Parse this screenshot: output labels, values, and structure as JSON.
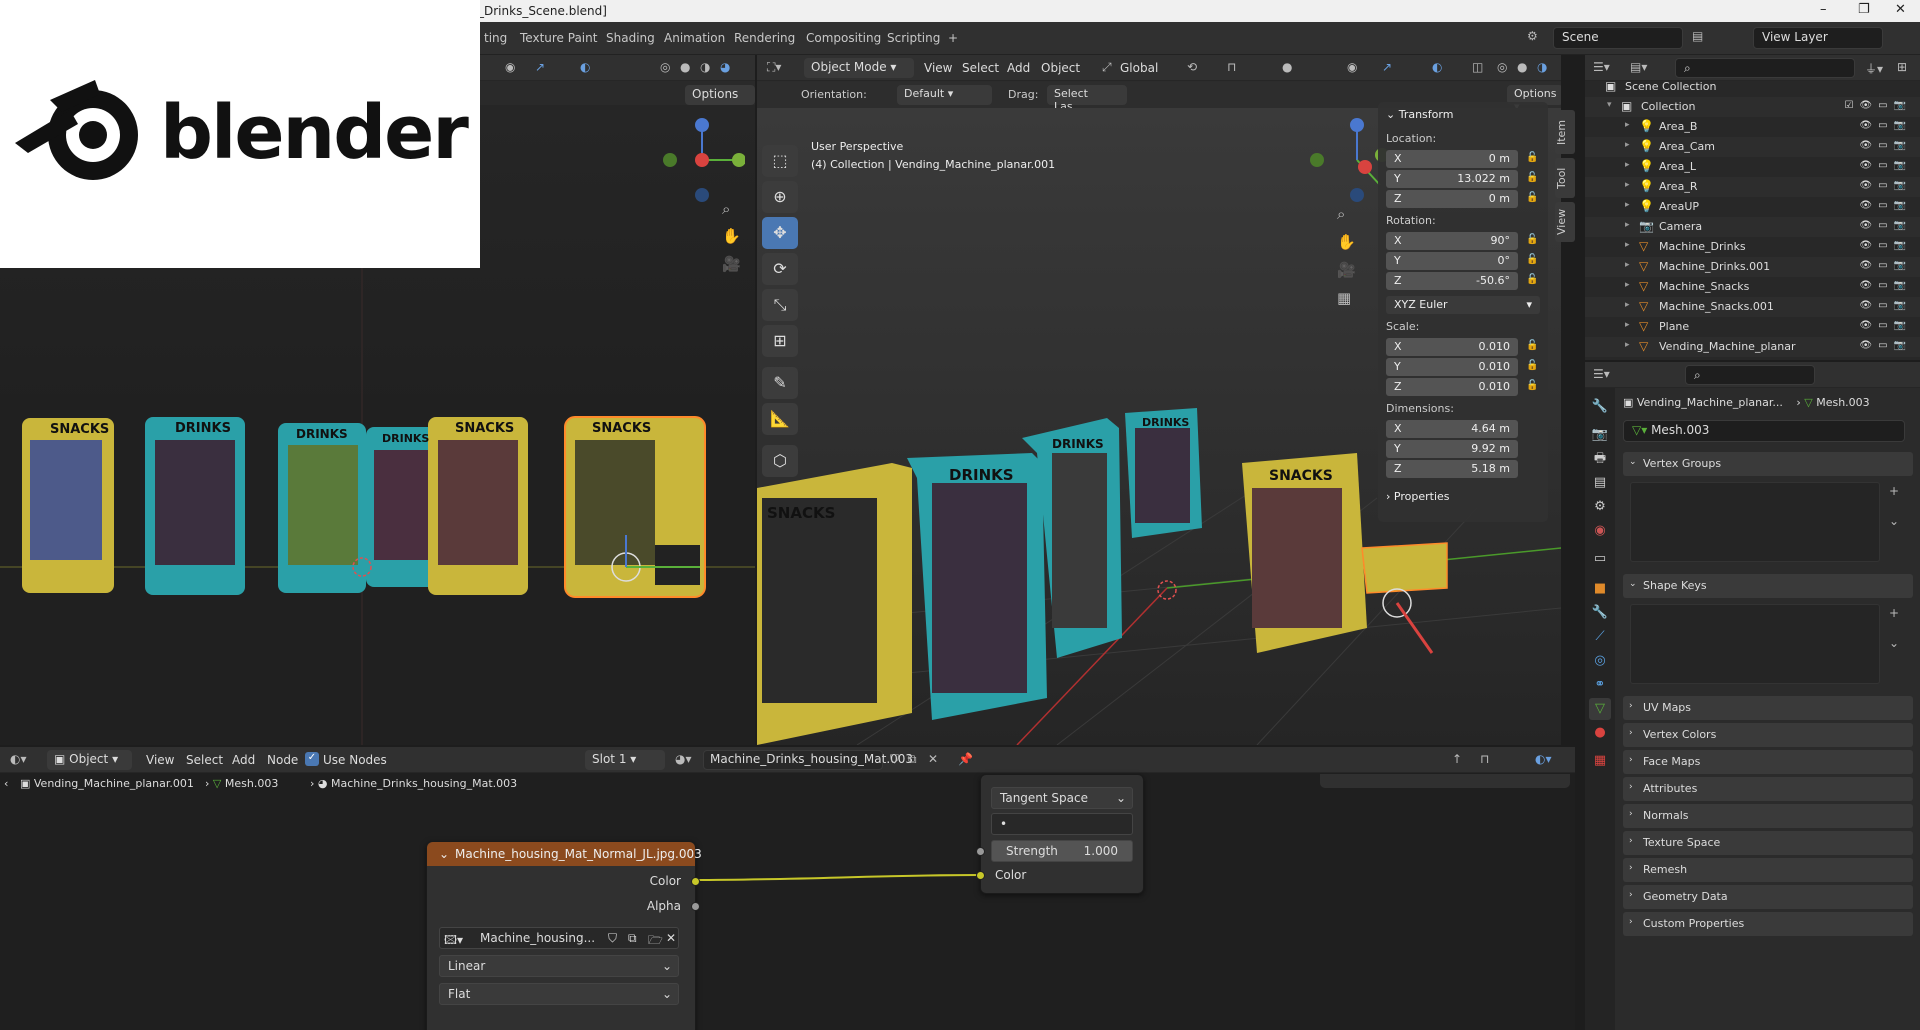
{
  "window": {
    "title": "_Drinks_Scene.blend]",
    "controls": [
      "–",
      "❐",
      "✕"
    ]
  },
  "workspace": {
    "tabs": [
      "ting",
      "Texture Paint",
      "Shading",
      "Animation",
      "Rendering",
      "Compositing",
      "Scripting",
      "+"
    ],
    "scene": "Scene",
    "view_layer": "View Layer"
  },
  "logo": {
    "text": "blender"
  },
  "left_viewport": {
    "options_label": "Options",
    "labels": [
      "SNACKS",
      "DRINKS",
      "DRINKS",
      "DRINKS",
      "SNACKS",
      "SNACKS"
    ]
  },
  "right_viewport": {
    "mode": "Object Mode",
    "menu": [
      "View",
      "Select",
      "Add",
      "Object"
    ],
    "transform_orientation": "Global",
    "orientation_label": "Orientation:",
    "orientation_value": "Default",
    "drag_label": "Drag:",
    "drag_value": "Select Las...",
    "options_label": "Options",
    "overlay_line1": "User Perspective",
    "overlay_line2": "(4) Collection | Vending_Machine_planar.001",
    "side_tabs": [
      "Item",
      "Tool",
      "View"
    ],
    "labels": [
      "SNACKS",
      "DRINKS",
      "DRINKS",
      "DRINKS",
      "SNACKS"
    ]
  },
  "npanel": {
    "title": "Transform",
    "location_label": "Location:",
    "location": [
      {
        "axis": "X",
        "value": "0 m"
      },
      {
        "axis": "Y",
        "value": "13.022 m"
      },
      {
        "axis": "Z",
        "value": "0 m"
      }
    ],
    "rotation_label": "Rotation:",
    "rotation": [
      {
        "axis": "X",
        "value": "90°"
      },
      {
        "axis": "Y",
        "value": "0°"
      },
      {
        "axis": "Z",
        "value": "-50.6°"
      }
    ],
    "rotation_mode": "XYZ Euler",
    "scale_label": "Scale:",
    "scale": [
      {
        "axis": "X",
        "value": "0.010"
      },
      {
        "axis": "Y",
        "value": "0.010"
      },
      {
        "axis": "Z",
        "value": "0.010"
      }
    ],
    "dimensions_label": "Dimensions:",
    "dimensions": [
      {
        "axis": "X",
        "value": "4.64 m"
      },
      {
        "axis": "Y",
        "value": "9.92 m"
      },
      {
        "axis": "Z",
        "value": "5.18 m"
      }
    ],
    "properties_label": "Properties"
  },
  "outliner": {
    "scene_collection": "Scene Collection",
    "collection": "Collection",
    "items": [
      {
        "name": "Area_B",
        "icon": "light-icon"
      },
      {
        "name": "Area_Cam",
        "icon": "light-icon"
      },
      {
        "name": "Area_L",
        "icon": "light-icon"
      },
      {
        "name": "Area_R",
        "icon": "light-icon"
      },
      {
        "name": "AreaUP",
        "icon": "light-icon"
      },
      {
        "name": "Camera",
        "icon": "camera-icon"
      },
      {
        "name": "Machine_Drinks",
        "icon": "mesh-icon"
      },
      {
        "name": "Machine_Drinks.001",
        "icon": "mesh-icon"
      },
      {
        "name": "Machine_Snacks",
        "icon": "mesh-icon"
      },
      {
        "name": "Machine_Snacks.001",
        "icon": "mesh-icon"
      },
      {
        "name": "Plane",
        "icon": "mesh-icon"
      },
      {
        "name": "Vending_Machine_planar",
        "icon": "mesh-icon"
      }
    ]
  },
  "properties": {
    "breadcrumb_object": "Vending_Machine_planar...",
    "breadcrumb_mesh": "Mesh.003",
    "mesh_name": "Mesh.003",
    "sections_open": [
      "Vertex Groups",
      "Shape Keys"
    ],
    "sections_closed": [
      "UV Maps",
      "Vertex Colors",
      "Face Maps",
      "Attributes",
      "Normals",
      "Texture Space",
      "Remesh",
      "Geometry Data",
      "Custom Properties"
    ]
  },
  "node_editor": {
    "editor_type": "Object",
    "menu": [
      "View",
      "Select",
      "Add",
      "Node"
    ],
    "use_nodes_label": "Use Nodes",
    "slot": "Slot 1",
    "material": "Machine_Drinks_housing_Mat.003",
    "breadcrumb": [
      "Vending_Machine_planar.001",
      "Mesh.003",
      "Machine_Drinks_housing_Mat.003"
    ],
    "image_node": {
      "title": "Machine_housing_Mat_Normal_JL.jpg.003",
      "out_color": "Color",
      "out_alpha": "Alpha",
      "image_name": "Machine_housing...",
      "interpolation": "Linear",
      "projection": "Flat"
    },
    "normal_node": {
      "space": "Tangent Space",
      "uv": "•",
      "strength_label": "Strength",
      "strength_value": "1.000",
      "in_color": "Color"
    }
  },
  "colors": {
    "accent": "#4a78b3",
    "node_header": "#8b4a1e",
    "socket_yellow": "#c7c729"
  }
}
